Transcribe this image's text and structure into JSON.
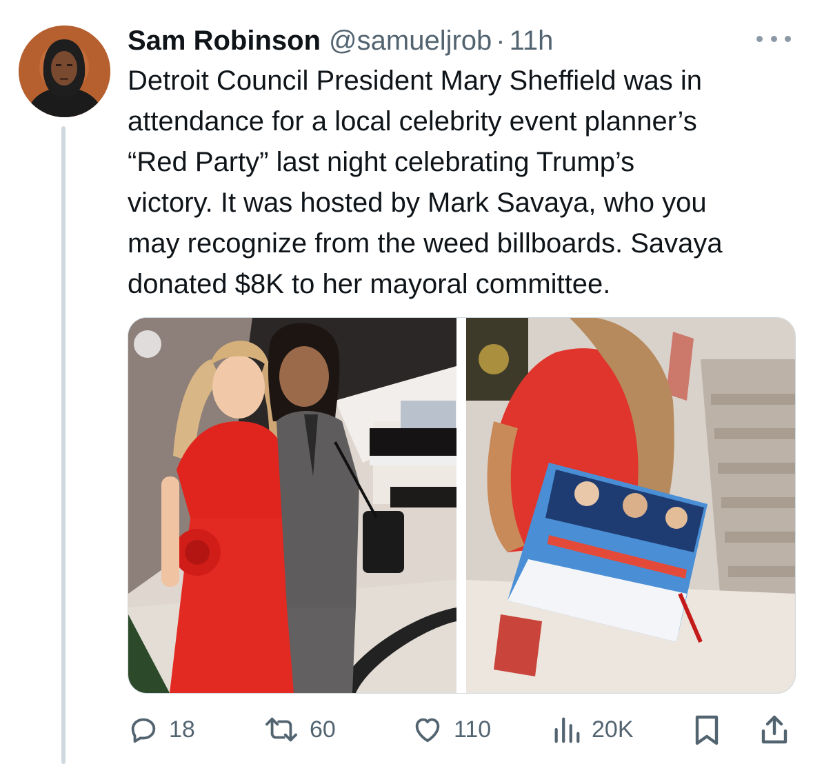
{
  "tweet": {
    "author_name": "Sam Robinson",
    "handle": "@samueljrob",
    "separator": "·",
    "time": "11h",
    "text": "Detroit Council President Mary Sheffield was in\nattendance for a local celebrity event planner’s\n“Red Party” last night celebrating Trump’s\nvictory. It was hosted by Mark Savaya, who you\nmay recognize from the weed billboards. Savaya\ndonated $8K to her mayoral committee."
  },
  "icons": {
    "more": "more-horizontal-icon",
    "reply": "reply-icon",
    "retweet": "retweet-icon",
    "like": "heart-icon",
    "views": "views-chart-icon",
    "bookmark": "bookmark-icon",
    "share": "share-icon"
  },
  "metrics": {
    "replies": "18",
    "retweets": "60",
    "likes": "110",
    "views": "20K"
  },
  "colors": {
    "text_primary": "#0f1419",
    "text_secondary": "#536471",
    "thread_line": "#cfd9de",
    "red_dress": "#e0251f"
  }
}
